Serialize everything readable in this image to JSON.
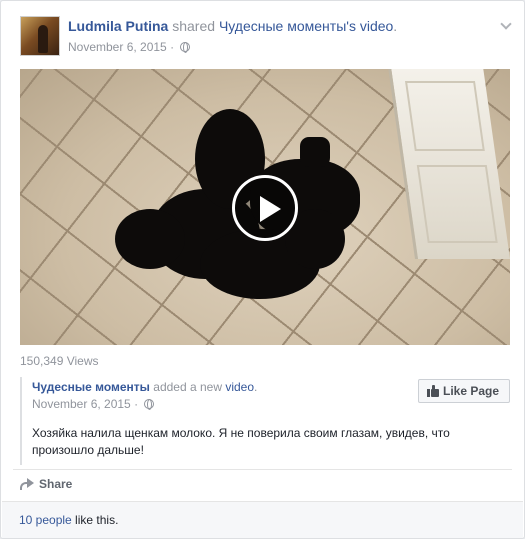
{
  "post": {
    "author": "Ludmila Putina",
    "action": " shared ",
    "page_name": "Чудесные моменты",
    "possessive": "'s ",
    "object": "video",
    "period": ".",
    "date": "November 6, 2015",
    "separator": " · "
  },
  "video": {
    "views": "150,349 Views"
  },
  "attachment": {
    "page_name": "Чудесные моменты",
    "action": " added a new ",
    "object": "video",
    "period": ".",
    "date": "November 6, 2015",
    "separator": " · ",
    "like_page_label": "Like Page",
    "text": "Хозяйка налила щенкам молоко. Я не поверила своим глазам, увидев, что произошло дальше!"
  },
  "actions": {
    "share_label": "Share"
  },
  "likes": {
    "link": "10 people",
    "suffix": " like this."
  },
  "icons": [
    "chevron-down-icon",
    "globe-icon",
    "play-icon",
    "thumbs-up-icon",
    "share-arrow-icon"
  ],
  "colors": {
    "link": "#365899",
    "muted": "#90949c",
    "text": "#1d2129"
  }
}
